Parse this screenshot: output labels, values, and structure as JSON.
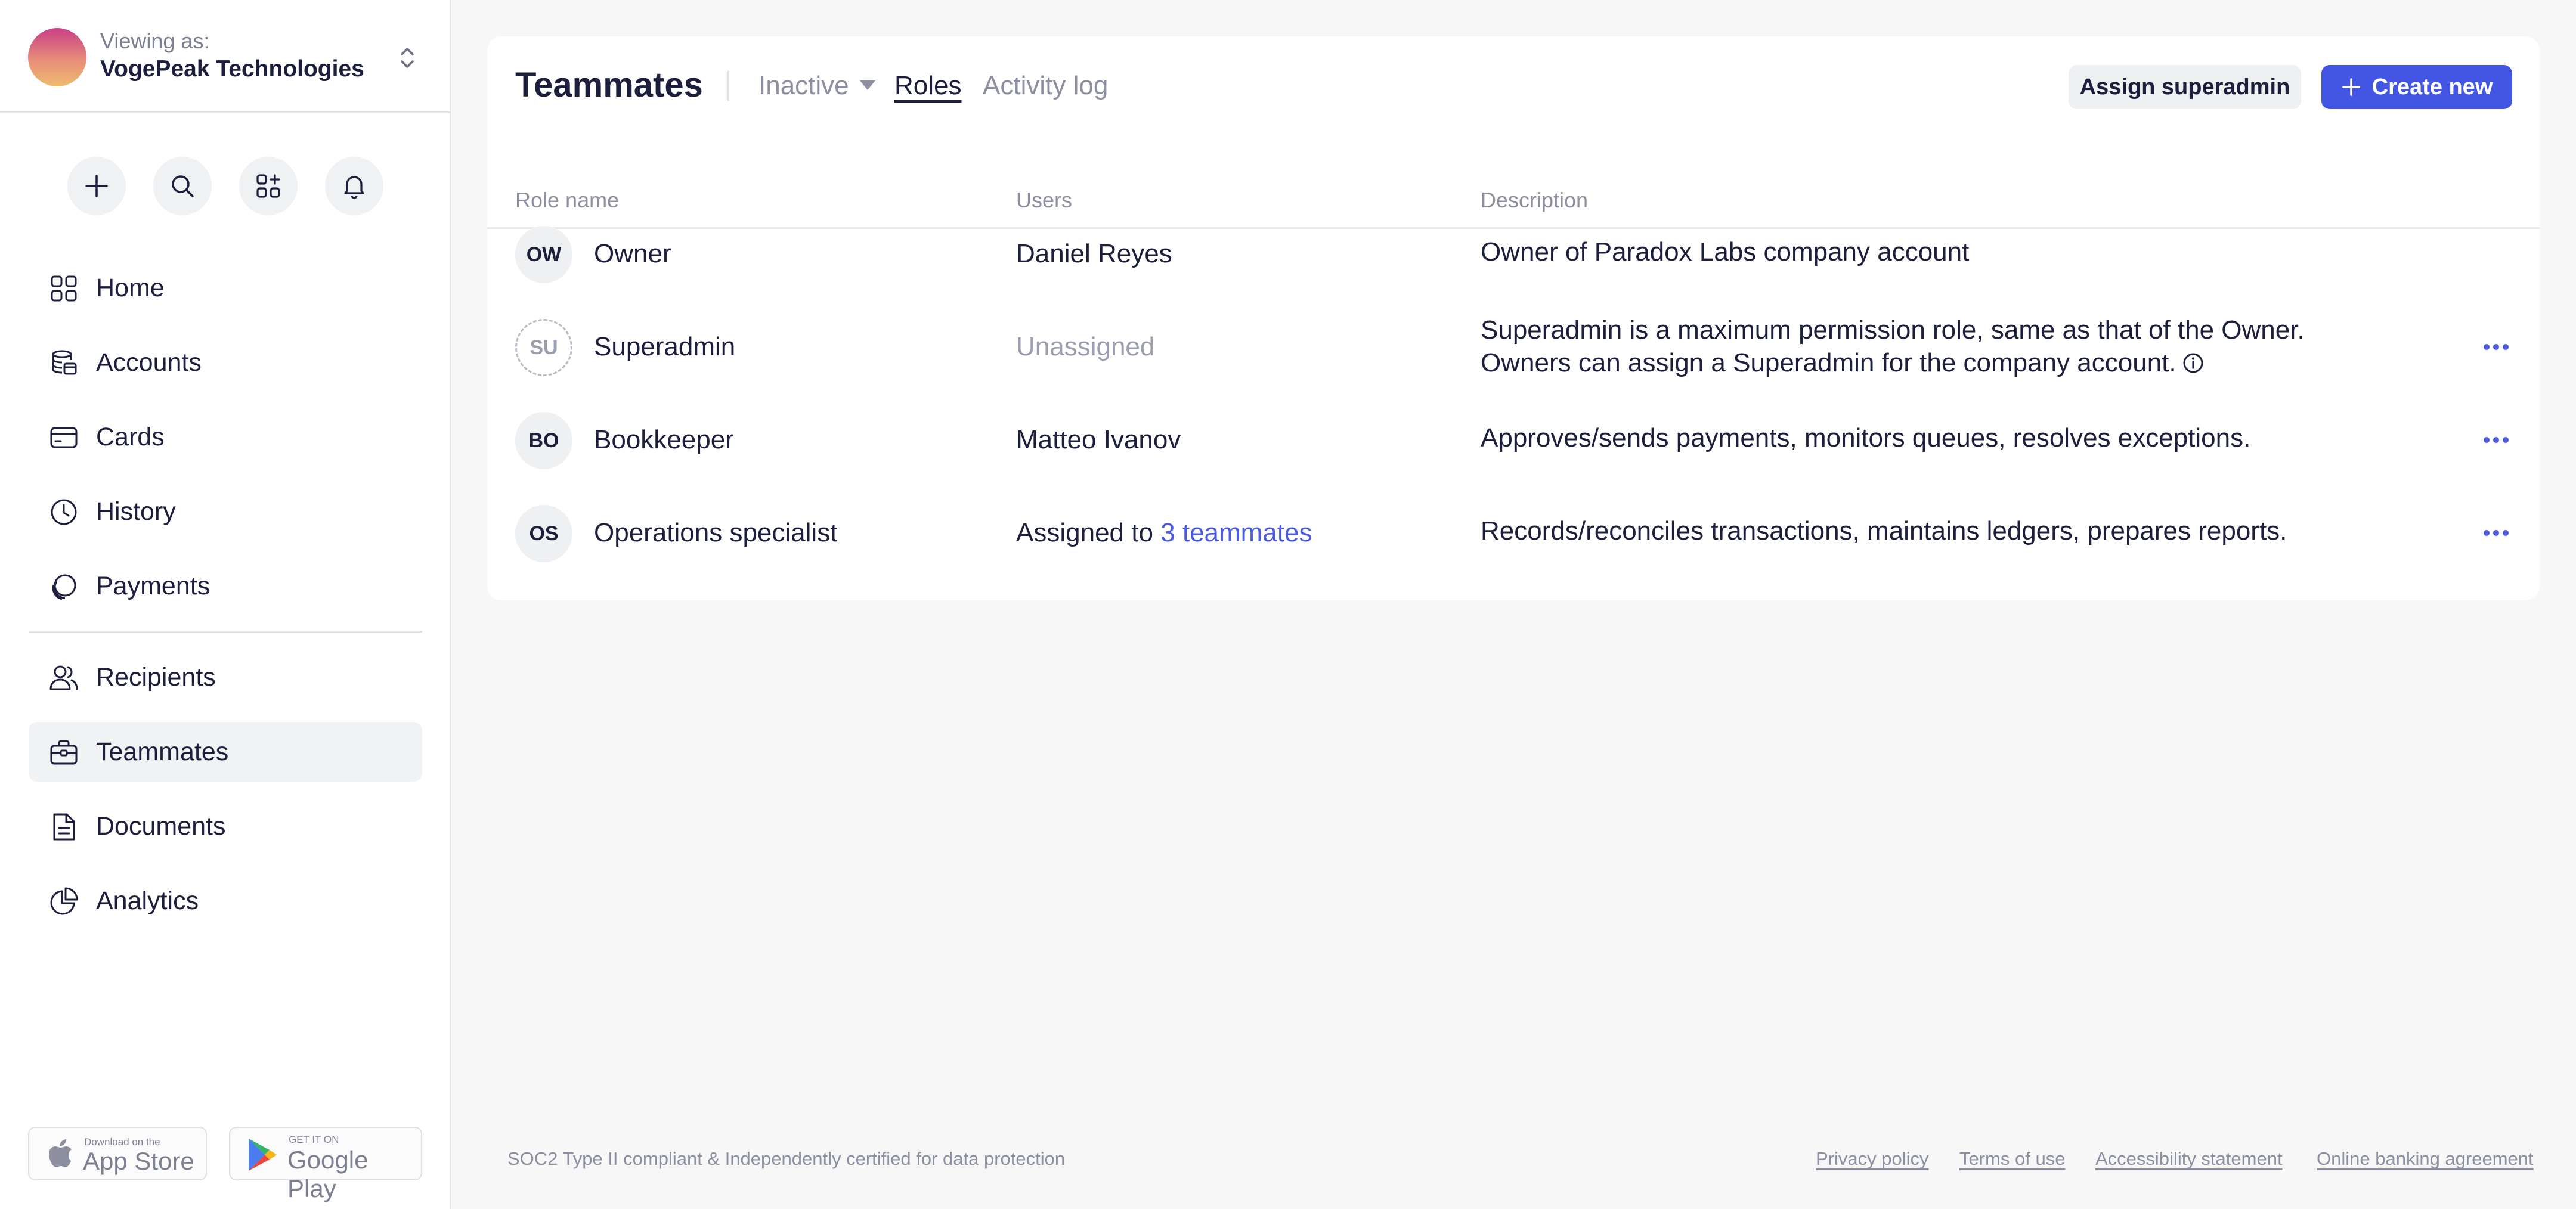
{
  "account": {
    "viewing_label": "Viewing as:",
    "company_name": "VogePeak Technologies"
  },
  "quick_actions": [
    {
      "icon": "plus-icon"
    },
    {
      "icon": "search-icon"
    },
    {
      "icon": "apps-icon"
    },
    {
      "icon": "bell-icon"
    }
  ],
  "nav": {
    "items": [
      {
        "label": "Home",
        "icon": "home-grid-icon"
      },
      {
        "label": "Accounts",
        "icon": "accounts-stack-icon"
      },
      {
        "label": "Cards",
        "icon": "card-icon"
      },
      {
        "label": "History",
        "icon": "clock-icon"
      },
      {
        "label": "Payments",
        "icon": "payments-icon"
      },
      {
        "label": "Recipients",
        "icon": "people-icon"
      },
      {
        "label": "Teammates",
        "icon": "briefcase-icon",
        "active": true
      },
      {
        "label": "Documents",
        "icon": "document-icon"
      },
      {
        "label": "Analytics",
        "icon": "pie-chart-icon"
      }
    ]
  },
  "stores": {
    "apple": {
      "small": "Download on the",
      "big": "App Store"
    },
    "google": {
      "small": "GET IT ON",
      "big": "Google Play"
    }
  },
  "page": {
    "title": "Teammates",
    "tabs": {
      "inactive": "Inactive",
      "roles": "Roles",
      "activity": "Activity log"
    },
    "actions": {
      "assign": "Assign superadmin",
      "create": "Create new"
    }
  },
  "table": {
    "headers": {
      "role": "Role name",
      "users": "Users",
      "description": "Description"
    },
    "rows": [
      {
        "initials": "OW",
        "role": "Owner",
        "users": "Daniel Reyes",
        "description": "Owner of Paradox Labs company account"
      },
      {
        "initials": "SU",
        "role": "Superadmin",
        "users": "Unassigned",
        "description_line1": "Superadmin is a maximum permission role, same as that of the Owner.",
        "description_line2": "Owners can assign a Superadmin for the company account."
      },
      {
        "initials": "BO",
        "role": "Bookkeeper",
        "users": "Matteo Ivanov",
        "description": "Approves/sends payments, monitors queues, resolves exceptions."
      },
      {
        "initials": "OS",
        "role": "Operations specialist",
        "users_prefix": "Assigned to ",
        "users_link": "3 teammates",
        "description": "Records/reconciles transactions, maintains ledgers, prepares reports."
      }
    ]
  },
  "footer": {
    "compliance": "SOC2 Type II compliant & Independently certified for data protection",
    "links": {
      "privacy": "Privacy policy",
      "terms": "Terms of use",
      "accessibility": "Accessibility statement",
      "banking": "Online banking agreement"
    }
  },
  "colors": {
    "accent": "#4355e3",
    "link": "#4a5bdc",
    "text": "#1b1f3b",
    "muted": "#8b8fa0"
  }
}
